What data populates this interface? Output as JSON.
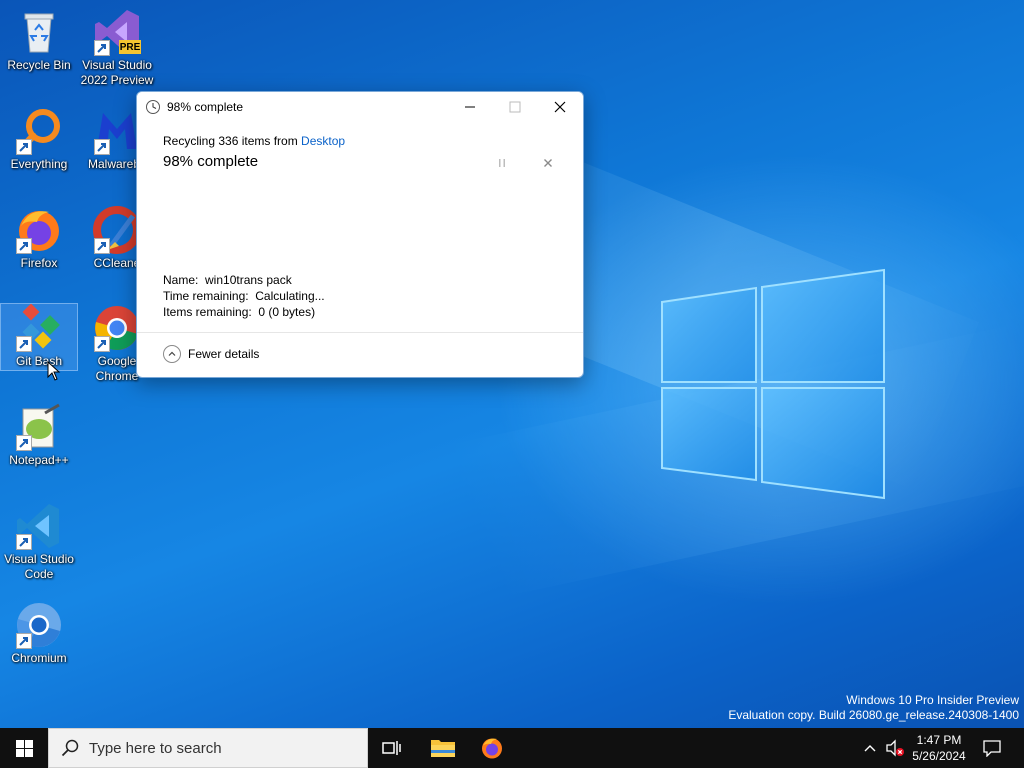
{
  "desktop": {
    "icons": [
      {
        "label": "Recycle Bin"
      },
      {
        "label": "Visual Studio 2022 Preview",
        "badge": "PRE"
      },
      {
        "label": "Everything"
      },
      {
        "label": "Malwareby"
      },
      {
        "label": "Firefox"
      },
      {
        "label": "CCleane"
      },
      {
        "label": "Git Bash"
      },
      {
        "label": "Google Chrome"
      },
      {
        "label": "Notepad++"
      },
      {
        "label": "Visual Studio Code"
      },
      {
        "label": "Chromium"
      }
    ]
  },
  "dialog": {
    "title": "98% complete",
    "line_prefix": "Recycling 336 items from ",
    "line_link": "Desktop",
    "status": "98% complete",
    "progress_percent": 98,
    "details": {
      "name_label": "Name:",
      "name_value": "win10trans pack",
      "time_label": "Time remaining:",
      "time_value": "Calculating...",
      "items_label": "Items remaining:",
      "items_value": "0 (0 bytes)"
    },
    "fewer_details": "Fewer details"
  },
  "watermark": {
    "line1": "Windows 10 Pro Insider Preview",
    "line2": "Evaluation copy. Build 26080.ge_release.240308-1400"
  },
  "taskbar": {
    "search_placeholder": "Type here to search",
    "time": "1:47 PM",
    "date": "5/26/2024"
  },
  "colors": {
    "accent": "#0a62c9",
    "taskbar": "#101010",
    "desktop": "#0f77d6"
  }
}
